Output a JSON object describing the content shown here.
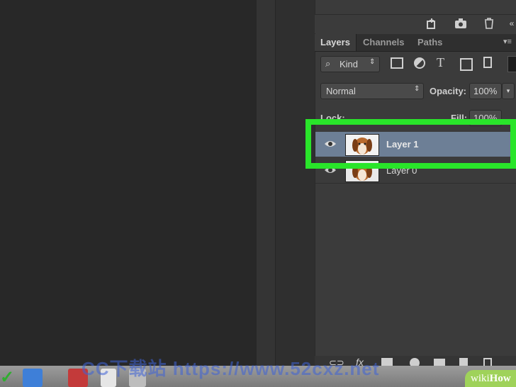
{
  "tabs": [
    {
      "label": "Layers",
      "active": true
    },
    {
      "label": "Channels",
      "active": false
    },
    {
      "label": "Paths",
      "active": false
    }
  ],
  "filter": {
    "label": "Kind"
  },
  "blend_mode": {
    "value": "Normal"
  },
  "opacity": {
    "label": "Opacity:",
    "value": "100%"
  },
  "lock": {
    "label": "Lock:"
  },
  "fill": {
    "label": "Fill:",
    "value": "100%"
  },
  "layers": [
    {
      "name": "Layer 1",
      "selected": true,
      "visible": true
    },
    {
      "name": "Layer 0",
      "selected": false,
      "visible": true
    }
  ],
  "bottom_bar": {
    "fx_label": "fx"
  },
  "watermark": {
    "text": "CC下载站 https://www.52cxz.net"
  },
  "brand": {
    "prefix": "wiki",
    "suffix": "How"
  },
  "colors": {
    "highlight": "#29e52a",
    "selected_row": "#6d7f96",
    "panel": "#3b3b3b"
  }
}
